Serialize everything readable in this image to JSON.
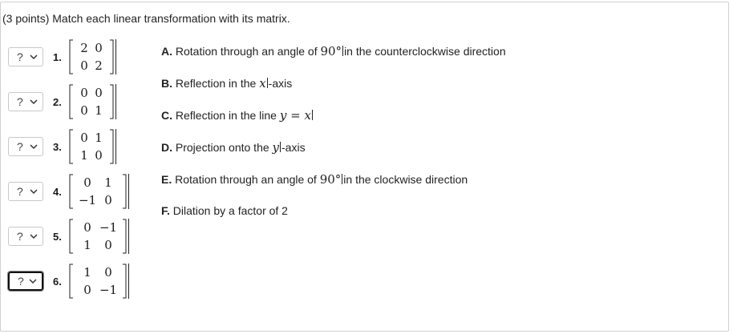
{
  "prompt": "(3 points) Match each linear transformation with its matrix.",
  "select_value": "?",
  "matrices": [
    {
      "number": "1.",
      "rows": [
        [
          "2",
          "0"
        ],
        [
          "0",
          "2"
        ]
      ]
    },
    {
      "number": "2.",
      "rows": [
        [
          "0",
          "0"
        ],
        [
          "0",
          "1"
        ]
      ]
    },
    {
      "number": "3.",
      "rows": [
        [
          "0",
          "1"
        ],
        [
          "1",
          "0"
        ]
      ]
    },
    {
      "number": "4.",
      "rows": [
        [
          "0",
          "1"
        ],
        [
          "−1",
          "0"
        ]
      ]
    },
    {
      "number": "5.",
      "rows": [
        [
          "0",
          "−1"
        ],
        [
          "1",
          "0"
        ]
      ]
    },
    {
      "number": "6.",
      "rows": [
        [
          "1",
          "0"
        ],
        [
          "0",
          "−1"
        ]
      ]
    }
  ],
  "options": [
    {
      "letter": "A.",
      "pre": "Rotation through an angle of ",
      "math": "90°",
      "post": "in the counterclockwise direction"
    },
    {
      "letter": "B.",
      "pre": "Reflection in the ",
      "math": "x",
      "post": "-axis"
    },
    {
      "letter": "C.",
      "pre": "Reflection in the line ",
      "math": "y = x",
      "post": ""
    },
    {
      "letter": "D.",
      "pre": "Projection onto the ",
      "math": "y",
      "post": "-axis"
    },
    {
      "letter": "E.",
      "pre": "Rotation through an angle of ",
      "math": "90°",
      "post": "in the clockwise direction"
    },
    {
      "letter": "F.",
      "pre": "Dilation by a factor of 2",
      "math": "",
      "post": ""
    }
  ]
}
